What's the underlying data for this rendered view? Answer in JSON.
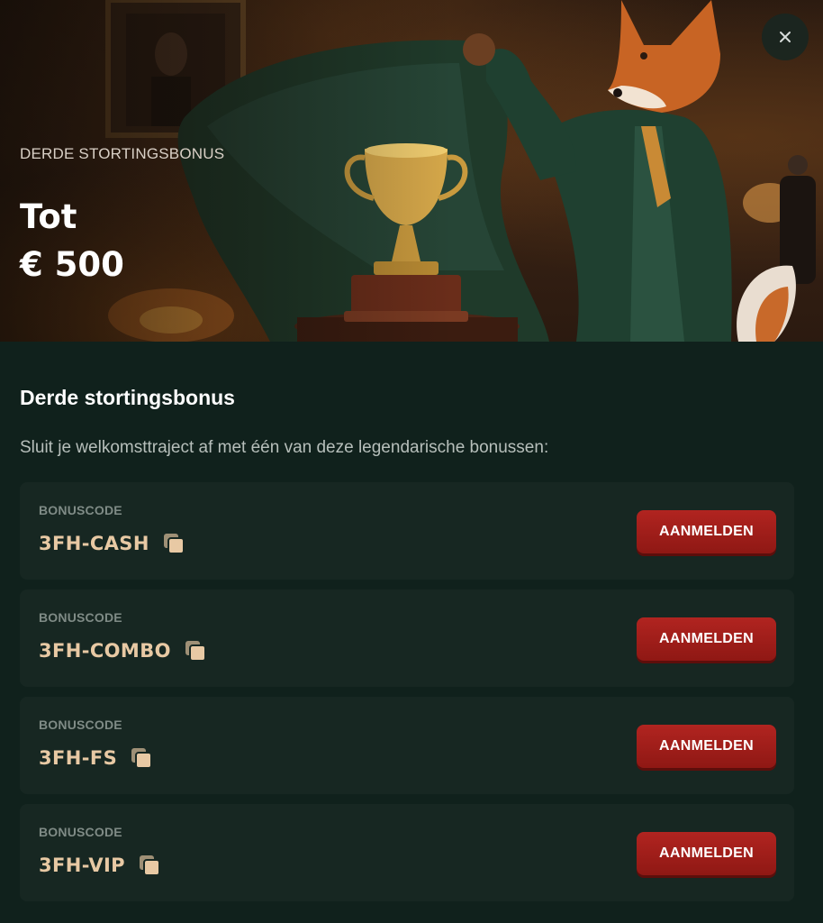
{
  "hero": {
    "kicker": "DERDE STORTINGSBONUS",
    "amount_line1": "Tot",
    "amount_line2": "€ 500",
    "close_icon": "close-icon"
  },
  "content": {
    "title": "Derde stortingsbonus",
    "description": "Sluit je welkomsttraject af met één van deze legendarische bonussen:"
  },
  "bonuses": [
    {
      "label": "BONUSCODE",
      "code": "3FH-CASH",
      "button": "AANMELDEN"
    },
    {
      "label": "BONUSCODE",
      "code": "3FH-COMBO",
      "button": "AANMELDEN"
    },
    {
      "label": "BONUSCODE",
      "code": "3FH-FS",
      "button": "AANMELDEN"
    },
    {
      "label": "BONUSCODE",
      "code": "3FH-VIP",
      "button": "AANMELDEN"
    }
  ],
  "colors": {
    "background": "#10211c",
    "card": "#172722",
    "code_text": "#e8c9a4",
    "button": "#a11f1b"
  }
}
